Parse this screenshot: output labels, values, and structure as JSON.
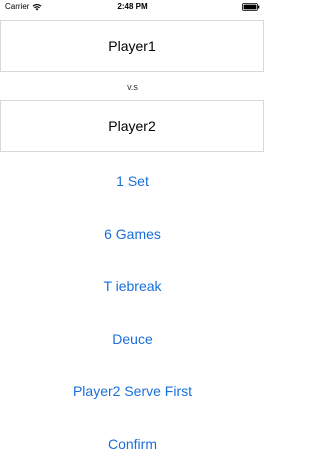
{
  "status_bar": {
    "carrier": "Carrier",
    "time": "2:48 PM",
    "wifi_icon": "wifi-icon",
    "battery_icon": "battery-icon"
  },
  "match_setup": {
    "player1": "Player1",
    "vs": "v.s",
    "player2": "Player2"
  },
  "options": {
    "sets": "1 Set",
    "games": "6 Games",
    "tiebreak": "T iebreak",
    "deuce": "Deuce",
    "serve_first": "Player2 Serve First",
    "confirm": "Confirm"
  },
  "colors": {
    "accent": "#1a6fd8",
    "border": "#d8d8d8"
  }
}
